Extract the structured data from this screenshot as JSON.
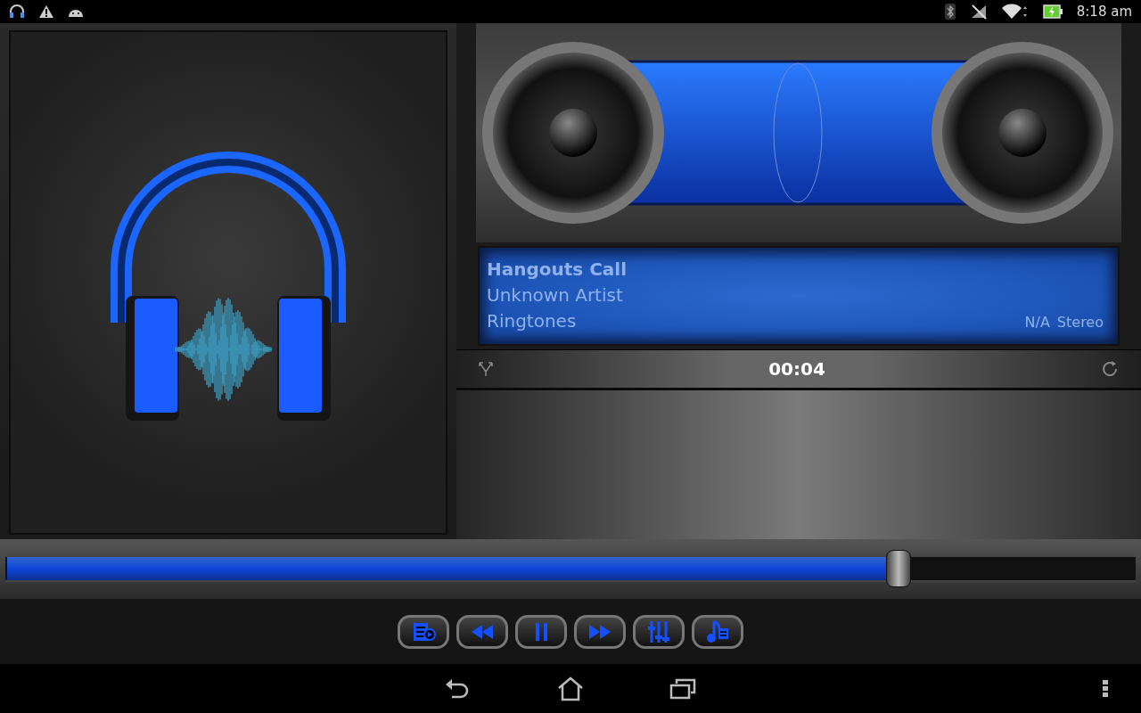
{
  "status_bar": {
    "time": "8:18 am"
  },
  "track": {
    "title": "Hangouts Call",
    "artist": "Unknown Artist",
    "album": "Ringtones",
    "quality": "N/A",
    "channels": "Stereo"
  },
  "elapsed": "00:04",
  "seek": {
    "level": 0.79
  },
  "controls": [
    {
      "kind": "playlist"
    },
    {
      "kind": "rewind"
    },
    {
      "kind": "pause"
    },
    {
      "kind": "forward"
    },
    {
      "kind": "equalizer"
    },
    {
      "kind": "library"
    }
  ]
}
